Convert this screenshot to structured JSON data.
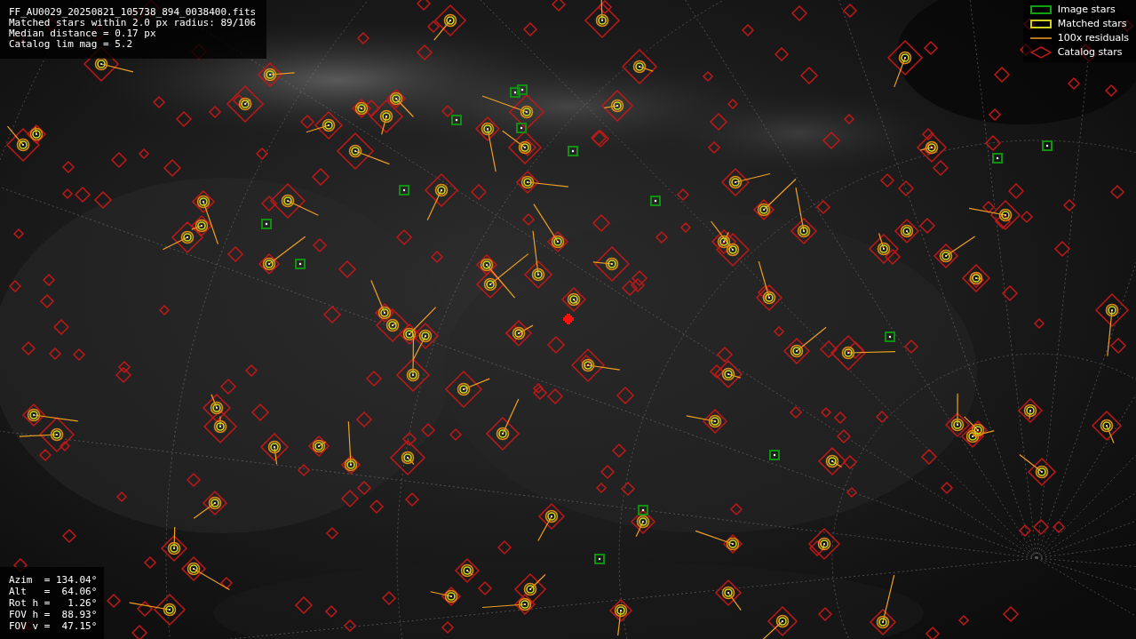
{
  "header": {
    "lines": [
      "FF_AU0029_20250821_105738_894_0038400.fits",
      "Matched stars within 2.0 px radius: 89/106",
      "Median distance = 0.17 px",
      "Catalog lim mag = 5.2"
    ]
  },
  "legend": [
    {
      "label": "Image stars"
    },
    {
      "kind": "matched",
      "label": "Matched stars"
    },
    {
      "kind": "residual",
      "label": "100x residuals"
    },
    {
      "kind": "catalog",
      "label": "Catalog stars"
    }
  ],
  "pointing": {
    "lines": [
      "Azim  = 134.04°",
      "Alt   =  64.06°",
      "Rot h =   1.26°",
      "FOV h =  88.93°",
      "FOV v =  47.15°"
    ]
  }
}
